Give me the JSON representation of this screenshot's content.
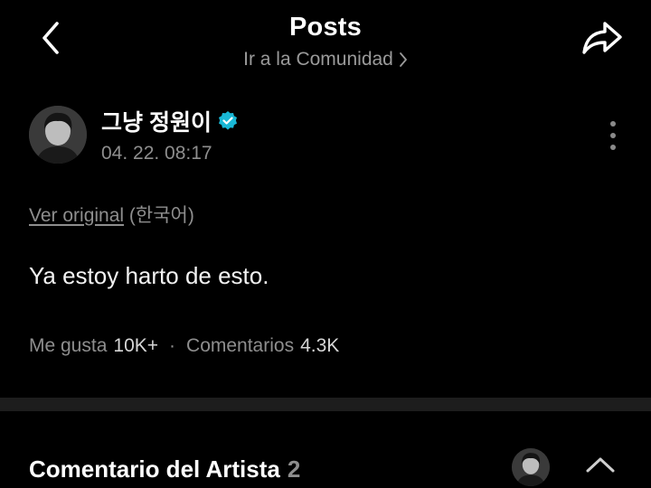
{
  "header": {
    "title": "Posts",
    "community_link": "Ir a la Comunidad",
    "icons": {
      "back": "chevron-left-icon",
      "share": "share-arrow-icon",
      "link_chevron": "chevron-right-icon"
    }
  },
  "post": {
    "author_name": "그냥 정원이",
    "verified": true,
    "date": "04. 22. 08:17",
    "view_original": "Ver original",
    "original_language": "(한국어)",
    "body": "Ya estoy harto de esto.",
    "likes_label": "Me gusta",
    "likes_count": "10K+",
    "separator": "·",
    "comments_label": "Comentarios",
    "comments_count": "4.3K"
  },
  "artist_comments": {
    "title": "Comentario del Artista",
    "count": "2"
  },
  "colors": {
    "background": "#000000",
    "verified_badge": "#19b8d6",
    "muted_text": "#8e8e8e",
    "divider": "#1d1d1d"
  }
}
